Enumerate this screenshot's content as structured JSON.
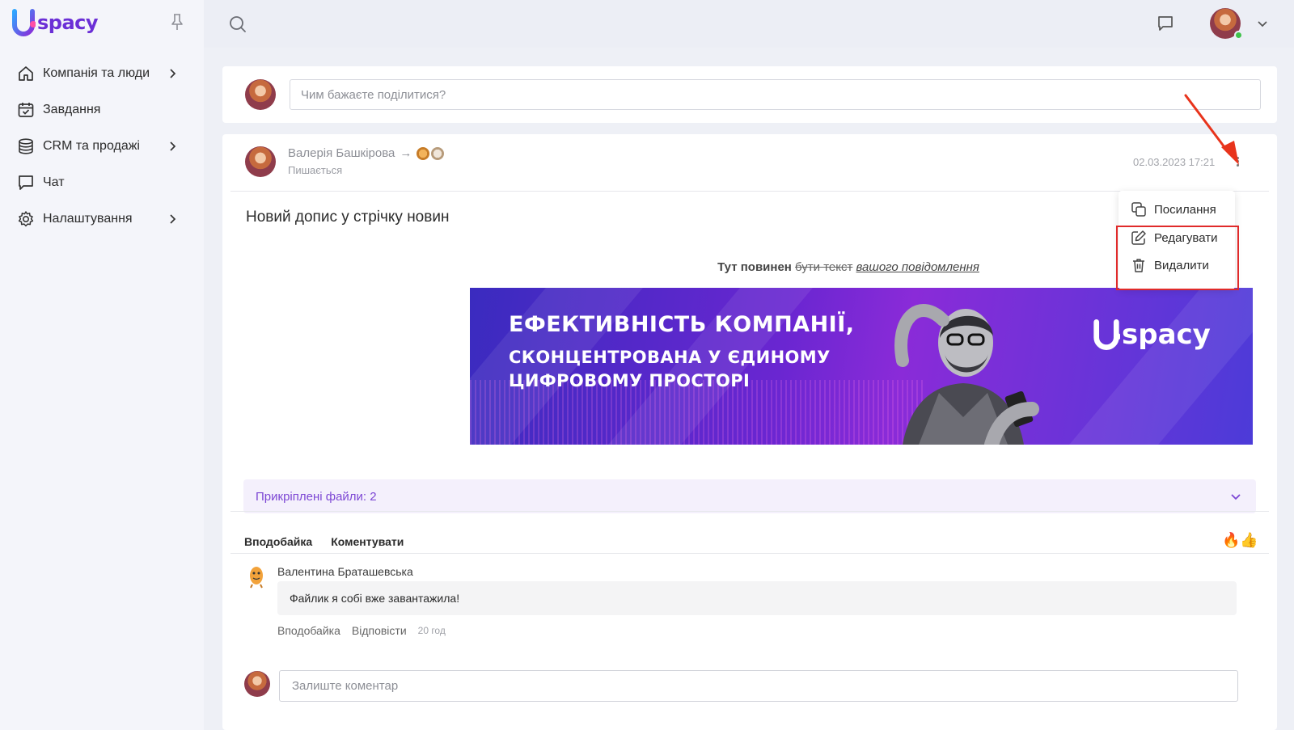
{
  "app": {
    "logo_text": "spacy"
  },
  "sidebar": {
    "items": [
      {
        "label": "Компанія та люди",
        "icon": "home-icon",
        "has_submenu": true
      },
      {
        "label": "Завдання",
        "icon": "calendar-check-icon",
        "has_submenu": false
      },
      {
        "label": "CRM та продажі",
        "icon": "database-icon",
        "has_submenu": true
      },
      {
        "label": "Чат",
        "icon": "chat-bubble-icon",
        "has_submenu": false
      },
      {
        "label": "Налаштування",
        "icon": "gear-icon",
        "has_submenu": true
      }
    ]
  },
  "composer": {
    "placeholder": "Чим бажаєте поділитися?"
  },
  "post": {
    "author": "Валерія Башкірова",
    "status": "Пишається",
    "date": "02.03.2023 17:21",
    "title": "Новий допис у стрічку новин",
    "text_bold": "Тут повинен",
    "text_strike": "бути текст",
    "text_italic": "вашого повідомлення",
    "banner": {
      "headline": "ЕФЕКТИВНІСТЬ КОМПАНІЇ,",
      "line2": "СКОНЦЕНТРОВАНА У ЄДИНОМУ",
      "line3": "ЦИФРОВОМУ ПРОСТОРІ",
      "logo_text": "spacy"
    },
    "attachments_label": "Прикріплені файли: 2",
    "actions": {
      "like": "Вподобайка",
      "comment": "Коментувати"
    },
    "reactions": "🔥👍"
  },
  "comment": {
    "author": "Валентина Браташевська",
    "text": "Файлик я собі вже завантажила!",
    "like": "Вподобайка",
    "reply": "Відповісти",
    "time": "20 год"
  },
  "reply_box": {
    "placeholder": "Залиште коментар"
  },
  "menu": {
    "items": [
      {
        "label": "Посилання",
        "icon": "copy-link-icon"
      },
      {
        "label": "Редагувати",
        "icon": "edit-icon"
      },
      {
        "label": "Видалити",
        "icon": "trash-icon"
      }
    ]
  },
  "colors": {
    "brand": "#6b2fd6",
    "accent_purple": "#7c46d4",
    "highlight_red": "#e02a2a",
    "online": "#3fc24a"
  }
}
